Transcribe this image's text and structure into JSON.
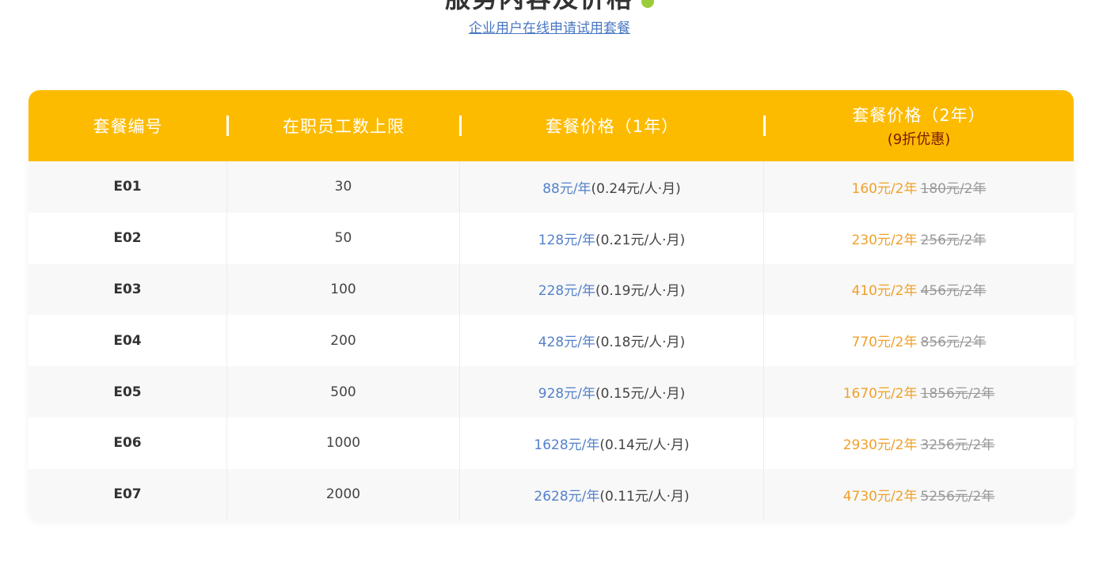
{
  "header": {
    "title": "服务内容及价格",
    "trial_link": "企业用户在线申请试用套餐"
  },
  "table": {
    "columns": [
      {
        "label": "套餐编号",
        "sub": ""
      },
      {
        "label": "在职员工数上限",
        "sub": ""
      },
      {
        "label": "套餐价格（1年）",
        "sub": ""
      },
      {
        "label": "套餐价格（2年）",
        "sub": "(9折优惠)"
      }
    ],
    "rows": [
      {
        "code": "E01",
        "limit": "30",
        "price1": "88元/年",
        "monthly": " (0.24元/人·月)",
        "price2": "160元/2年",
        "original": "180元/2年"
      },
      {
        "code": "E02",
        "limit": "50",
        "price1": "128元/年",
        "monthly": "(0.21元/人·月)",
        "price2": "230元/2年",
        "original": "256元/2年"
      },
      {
        "code": "E03",
        "limit": "100",
        "price1": "228元/年",
        "monthly": " (0.19元/人·月)",
        "price2": "410元/2年",
        "original": "456元/2年"
      },
      {
        "code": "E04",
        "limit": "200",
        "price1": "428元/年",
        "monthly": " (0.18元/人·月)",
        "price2": "770元/2年",
        "original": "856元/2年"
      },
      {
        "code": "E05",
        "limit": "500",
        "price1": "928元/年",
        "monthly": " (0.15元/人·月)",
        "price2": "1670元/2年",
        "original": "1856元/2年"
      },
      {
        "code": "E06",
        "limit": "1000",
        "price1": "1628元/年",
        "monthly": " (0.14元/人·月)",
        "price2": "2930元/2年",
        "original": "3256元/2年"
      },
      {
        "code": "E07",
        "limit": "2000",
        "price1": "2628元/年",
        "monthly": " (0.11元/人·月)",
        "price2": "4730元/2年",
        "original": "5256元/2年"
      }
    ]
  },
  "colors": {
    "header_bg": "#fdbb00",
    "link": "#4a78c2",
    "price_blue": "#5481c9",
    "price_orange": "#f0a02a",
    "discount_text": "#7a1a00"
  }
}
